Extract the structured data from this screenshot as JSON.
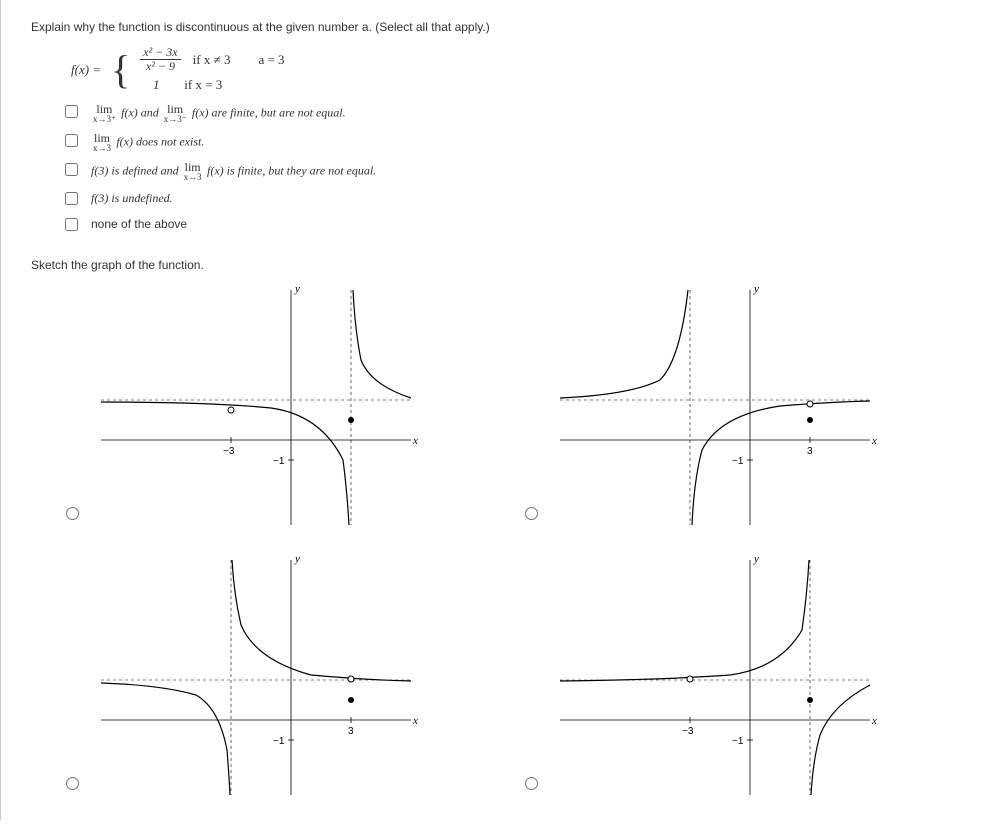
{
  "prompt": "Explain why the function is discontinuous at the given number a. (Select all that apply.)",
  "function": {
    "lhs": "f(x) =",
    "frac_num": "x² − 3x",
    "frac_den": "x² − 9",
    "cond1": "if x ≠ 3",
    "val2": "1",
    "cond2": "if x = 3",
    "a_eq": "a = 3"
  },
  "options": {
    "o1_pre": "",
    "o1_lim1_bot": "x→3⁺",
    "o1_mid1": " f(x)  and  ",
    "o1_lim2_bot": "x→3⁻",
    "o1_post": " f(x)  are finite, but are not equal.",
    "o2_lim_bot": "x→3",
    "o2_post": " f(x)  does not exist.",
    "o3_pre": "f(3) is defined and ",
    "o3_lim_bot": "x→3",
    "o3_post": " f(x)  is finite, but they are not equal.",
    "o4": "f(3) is undefined.",
    "o5": "none of the above"
  },
  "sketch": "Sketch the graph of the function.",
  "axis": {
    "x": "x",
    "y": "y",
    "m3": "−3",
    "p3": "3",
    "m1": "−1"
  },
  "lim_word": "lim"
}
